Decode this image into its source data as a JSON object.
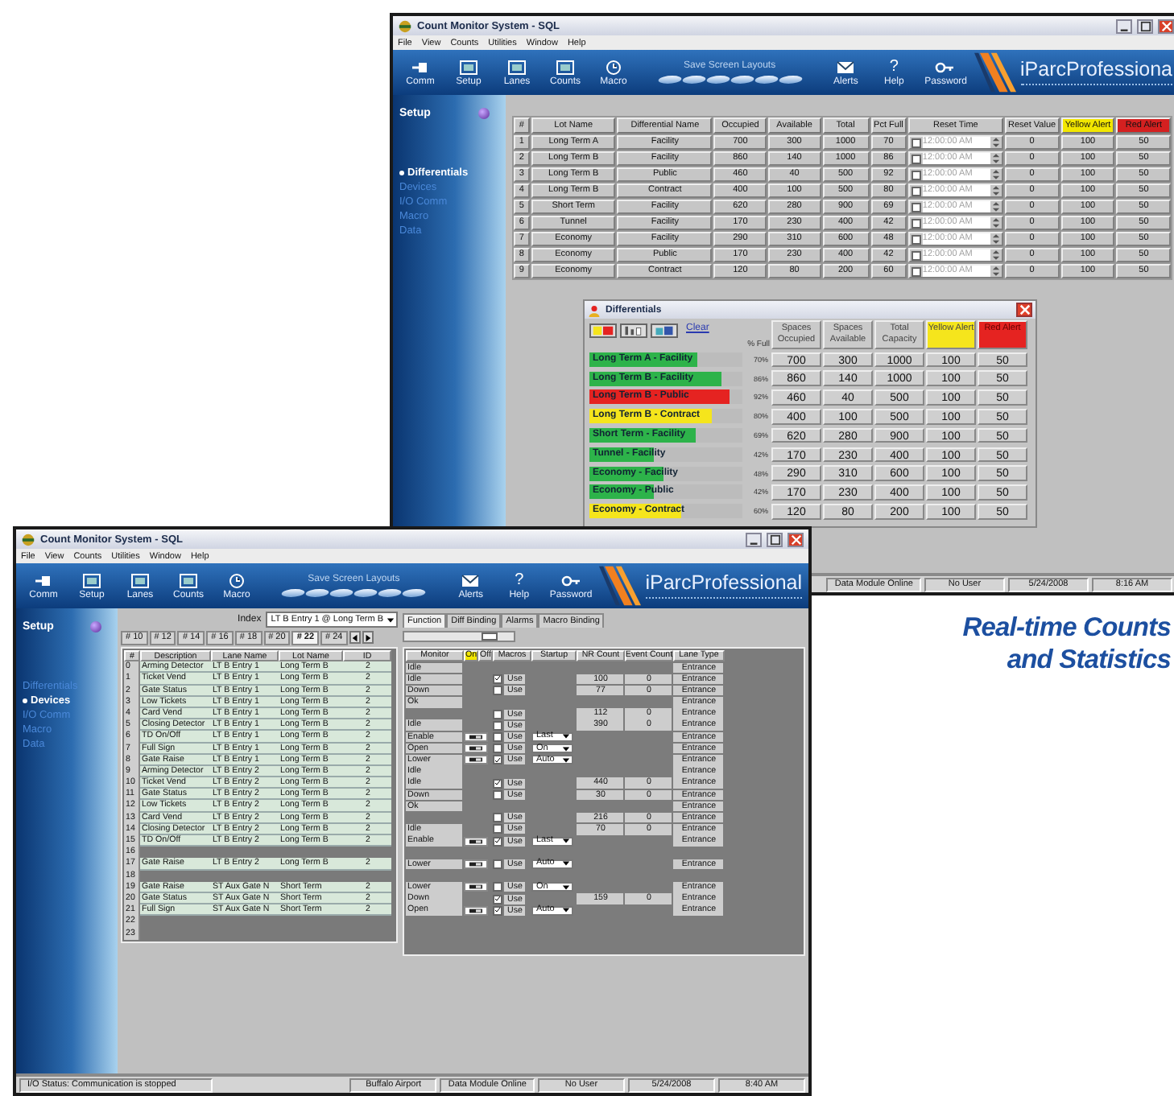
{
  "windows": [
    {
      "kind": "differentials",
      "title": "Count Monitor System - SQL",
      "menu": [
        "File",
        "View",
        "Counts",
        "Utilities",
        "Window",
        "Help"
      ],
      "toolbar": {
        "left": [
          {
            "kind": "plug",
            "label": "Comm"
          },
          {
            "kind": "screen",
            "label": "Setup"
          },
          {
            "kind": "screen",
            "label": "Lanes"
          },
          {
            "kind": "screen",
            "label": "Counts"
          },
          {
            "kind": "clock",
            "label": "Macro"
          }
        ],
        "layouts_label": "Save Screen Layouts",
        "right": [
          {
            "kind": "envelope",
            "label": "Alerts"
          },
          {
            "kind": "glyph",
            "glyph": "?",
            "label": "Help"
          },
          {
            "kind": "key",
            "label": "Password"
          }
        ],
        "logo": "iParcProfessiona"
      },
      "sidebar": {
        "title": "Setup",
        "items": [
          {
            "label": "Differentials",
            "selected": true
          },
          {
            "label": "Devices",
            "selected": false
          },
          {
            "label": "I/O Comm",
            "selected": false
          },
          {
            "label": "Macro",
            "selected": false
          },
          {
            "label": "Data",
            "selected": false
          }
        ]
      },
      "table": {
        "columns": [
          {
            "label": "#"
          },
          {
            "label": "Lot Name"
          },
          {
            "label": "Differential Name"
          },
          {
            "label": "Occupied"
          },
          {
            "label": "Available"
          },
          {
            "label": "Total"
          },
          {
            "label": "Pct Full"
          },
          {
            "label": "Reset Time"
          },
          {
            "label": "Reset Value"
          },
          {
            "label": "Yellow Alert",
            "color": "#f2e600"
          },
          {
            "label": "Red Alert",
            "color": "#d42020"
          }
        ],
        "rows": [
          {
            "no": "1",
            "lot": "Long Term A",
            "diff": "Facility",
            "occupied": "700",
            "available": "300",
            "total": "1000",
            "pct": "70",
            "reset_checked": false,
            "reset_enabled": false,
            "reset_time": "12:00:00 AM",
            "reset_value": "0",
            "yellow": "100",
            "red": "50"
          },
          {
            "no": "2",
            "lot": "Long Term B",
            "diff": "Facility",
            "occupied": "860",
            "available": "140",
            "total": "1000",
            "pct": "86",
            "reset_checked": false,
            "reset_enabled": false,
            "reset_time": "12:00:00 AM",
            "reset_value": "0",
            "yellow": "100",
            "red": "50"
          },
          {
            "no": "3",
            "lot": "Long Term B",
            "diff": "Public",
            "occupied": "460",
            "available": "40",
            "total": "500",
            "pct": "92",
            "reset_checked": false,
            "reset_enabled": false,
            "reset_time": "12:00:00 AM",
            "reset_value": "0",
            "yellow": "100",
            "red": "50"
          },
          {
            "no": "4",
            "lot": "Long Term B",
            "diff": "Contract",
            "occupied": "400",
            "available": "100",
            "total": "500",
            "pct": "80",
            "reset_checked": false,
            "reset_enabled": false,
            "reset_time": "12:00:00 AM",
            "reset_value": "0",
            "yellow": "100",
            "red": "50"
          },
          {
            "no": "5",
            "lot": "Short Term",
            "diff": "Facility",
            "occupied": "620",
            "available": "280",
            "total": "900",
            "pct": "69",
            "reset_checked": false,
            "reset_enabled": false,
            "reset_time": "12:00:00 AM",
            "reset_value": "0",
            "yellow": "100",
            "red": "50"
          },
          {
            "no": "6",
            "lot": "Tunnel",
            "diff": "Facility",
            "occupied": "170",
            "available": "230",
            "total": "400",
            "pct": "42",
            "reset_checked": false,
            "reset_enabled": false,
            "reset_time": "12:00:00 AM",
            "reset_value": "0",
            "yellow": "100",
            "red": "50"
          },
          {
            "no": "7",
            "lot": "Economy",
            "diff": "Facility",
            "occupied": "290",
            "available": "310",
            "total": "600",
            "pct": "48",
            "reset_checked": false,
            "reset_enabled": false,
            "reset_time": "12:00:00 AM",
            "reset_value": "0",
            "yellow": "100",
            "red": "50"
          },
          {
            "no": "8",
            "lot": "Economy",
            "diff": "Public",
            "occupied": "170",
            "available": "230",
            "total": "400",
            "pct": "42",
            "reset_checked": false,
            "reset_enabled": false,
            "reset_time": "12:00:00 AM",
            "reset_value": "0",
            "yellow": "100",
            "red": "50"
          },
          {
            "no": "9",
            "lot": "Economy",
            "diff": "Contract",
            "occupied": "120",
            "available": "80",
            "total": "200",
            "pct": "60",
            "reset_checked": false,
            "reset_enabled": false,
            "reset_time": "12:00:00 AM",
            "reset_value": "0",
            "yellow": "100",
            "red": "50"
          }
        ]
      },
      "status_bar": [
        "Data Module Online",
        "No User",
        "5/24/2008",
        "8:16 AM"
      ]
    },
    {
      "kind": "devices",
      "title": "Count Monitor System - SQL",
      "menu": [
        "File",
        "View",
        "Counts",
        "Utilities",
        "Window",
        "Help"
      ],
      "toolbar": {
        "left": [
          {
            "kind": "plug",
            "label": "Comm"
          },
          {
            "kind": "screen",
            "label": "Setup"
          },
          {
            "kind": "screen",
            "label": "Lanes"
          },
          {
            "kind": "screen",
            "label": "Counts"
          },
          {
            "kind": "clock",
            "label": "Macro"
          }
        ],
        "layouts_label": "Save Screen Layouts",
        "right": [
          {
            "kind": "envelope",
            "label": "Alerts"
          },
          {
            "kind": "glyph",
            "glyph": "?",
            "label": "Help"
          },
          {
            "kind": "key",
            "label": "Password"
          }
        ],
        "logo": "iParcProfessional"
      },
      "sidebar": {
        "title": "Setup",
        "items": [
          {
            "label": "Differentials",
            "selected": false
          },
          {
            "label": "Devices",
            "selected": true
          },
          {
            "label": "I/O Comm",
            "selected": false
          },
          {
            "label": "Macro",
            "selected": false
          },
          {
            "label": "Data",
            "selected": false
          }
        ]
      },
      "index": {
        "label": "Index",
        "value": "LT B Entry 1 @ Long Term B"
      },
      "lane_tabs": [
        {
          "label": "# 10",
          "selected": false
        },
        {
          "label": "# 12",
          "selected": false
        },
        {
          "label": "# 14",
          "selected": false
        },
        {
          "label": "# 16",
          "selected": false
        },
        {
          "label": "# 18",
          "selected": false
        },
        {
          "label": "# 20",
          "selected": false
        },
        {
          "label": "# 22",
          "selected": true
        },
        {
          "label": "# 24",
          "selected": false
        }
      ],
      "function_tabs": [
        {
          "label": "Function",
          "selected": true
        },
        {
          "label": "Diff Binding",
          "selected": false
        },
        {
          "label": "Alarms",
          "selected": false
        },
        {
          "label": "Macro Binding",
          "selected": false
        }
      ],
      "device_table": {
        "columns": [
          "#",
          "Description",
          "Lane Name",
          "Lot Name",
          "ID"
        ],
        "rows": [
          {
            "no": "0",
            "description": "Arming Detector",
            "lane": "LT B Entry 1",
            "lot": "Long Term B",
            "id": "2"
          },
          {
            "no": "1",
            "description": "Ticket Vend",
            "lane": "LT B Entry 1",
            "lot": "Long Term B",
            "id": "2"
          },
          {
            "no": "2",
            "description": "Gate Status",
            "lane": "LT B Entry 1",
            "lot": "Long Term B",
            "id": "2"
          },
          {
            "no": "3",
            "description": "Low Tickets",
            "lane": "LT B Entry 1",
            "lot": "Long Term B",
            "id": "2"
          },
          {
            "no": "4",
            "description": "Card Vend",
            "lane": "LT B Entry 1",
            "lot": "Long Term B",
            "id": "2"
          },
          {
            "no": "5",
            "description": "Closing Detector",
            "lane": "LT B Entry 1",
            "lot": "Long Term B",
            "id": "2"
          },
          {
            "no": "6",
            "description": "TD On/Off",
            "lane": "LT B Entry 1",
            "lot": "Long Term B",
            "id": "2"
          },
          {
            "no": "7",
            "description": "Full Sign",
            "lane": "LT B Entry 1",
            "lot": "Long Term B",
            "id": "2"
          },
          {
            "no": "8",
            "description": "Gate Raise",
            "lane": "LT B Entry 1",
            "lot": "Long Term B",
            "id": "2"
          },
          {
            "no": "9",
            "description": "Arming Detector",
            "lane": "LT B Entry 2",
            "lot": "Long Term B",
            "id": "2"
          },
          {
            "no": "10",
            "description": "Ticket Vend",
            "lane": "LT B Entry 2",
            "lot": "Long Term B",
            "id": "2"
          },
          {
            "no": "11",
            "description": "Gate Status",
            "lane": "LT B Entry 2",
            "lot": "Long Term B",
            "id": "2"
          },
          {
            "no": "12",
            "description": "Low Tickets",
            "lane": "LT B Entry 2",
            "lot": "Long Term B",
            "id": "2"
          },
          {
            "no": "13",
            "description": "Card Vend",
            "lane": "LT B Entry 2",
            "lot": "Long Term B",
            "id": "2"
          },
          {
            "no": "14",
            "description": "Closing Detector",
            "lane": "LT B Entry 2",
            "lot": "Long Term B",
            "id": "2"
          },
          {
            "no": "15",
            "description": "TD On/Off",
            "lane": "LT B Entry 2",
            "lot": "Long Term B",
            "id": "2"
          },
          {
            "no": "16"
          },
          {
            "no": "17",
            "description": "Gate Raise",
            "lane": "LT B Entry 2",
            "lot": "Long Term B",
            "id": "2"
          },
          {
            "no": "18"
          },
          {
            "no": "19",
            "description": "Gate Raise",
            "lane": "ST Aux Gate N",
            "lot": "Short Term",
            "id": "2"
          },
          {
            "no": "20",
            "description": "Gate Status",
            "lane": "ST Aux Gate N",
            "lot": "Short Term",
            "id": "2"
          },
          {
            "no": "21",
            "description": "Full Sign",
            "lane": "ST Aux Gate N",
            "lot": "Short Term",
            "id": "2"
          },
          {
            "no": "22"
          },
          {
            "no": "23"
          }
        ]
      },
      "monitor_table": {
        "columns": [
          "Monitor",
          "On",
          "Off",
          "Macros",
          "Startup",
          "NR Count",
          "Event Count",
          "Lane Type"
        ],
        "rows": [
          {
            "monitor": "Idle",
            "lane_type": "Entrance"
          },
          {
            "monitor": "Idle",
            "use": "Use",
            "use_checked": true,
            "nr_count": "100",
            "event_count": "0",
            "lane_type": "Entrance"
          },
          {
            "monitor": "Down",
            "use": "Use",
            "use_checked": false,
            "nr_count": "77",
            "event_count": "0",
            "lane_type": "Entrance"
          },
          {
            "monitor": "Ok",
            "lane_type": "Entrance"
          },
          {
            "use": "Use",
            "use_checked": false,
            "nr_count": "112",
            "event_count": "0",
            "lane_type": "Entrance"
          },
          {
            "monitor": "Idle",
            "use": "Use",
            "use_checked": false,
            "nr_count": "390",
            "event_count": "0",
            "lane_type": "Entrance"
          },
          {
            "monitor": "Enable",
            "switch": true,
            "use": "Use",
            "use_checked": false,
            "startup": "Last",
            "lane_type": "Entrance"
          },
          {
            "monitor": "Open",
            "switch": true,
            "use": "Use",
            "use_checked": false,
            "startup": "On",
            "lane_type": "Entrance"
          },
          {
            "monitor": "Lower",
            "switch": true,
            "use": "Use",
            "use_checked": true,
            "startup": "Auto",
            "lane_type": "Entrance"
          },
          {
            "monitor": "Idle",
            "lane_type": "Entrance"
          },
          {
            "monitor": "Idle",
            "use": "Use",
            "use_checked": true,
            "nr_count": "440",
            "event_count": "0",
            "lane_type": "Entrance"
          },
          {
            "monitor": "Down",
            "use": "Use",
            "use_checked": false,
            "nr_count": "30",
            "event_count": "0",
            "lane_type": "Entrance"
          },
          {
            "monitor": "Ok",
            "lane_type": "Entrance"
          },
          {
            "use": "Use",
            "use_checked": false,
            "nr_count": "216",
            "event_count": "0",
            "lane_type": "Entrance"
          },
          {
            "monitor": "Idle",
            "use": "Use",
            "use_checked": false,
            "nr_count": "70",
            "event_count": "0",
            "lane_type": "Entrance"
          },
          {
            "monitor": "Enable",
            "switch": true,
            "use": "Use",
            "use_checked": true,
            "startup": "Last",
            "lane_type": "Entrance"
          },
          {},
          {
            "monitor": "Lower",
            "switch": true,
            "use": "Use",
            "use_checked": false,
            "startup": "Auto",
            "lane_type": "Entrance"
          },
          {},
          {
            "monitor": "Lower",
            "switch": true,
            "use": "Use",
            "use_checked": false,
            "startup": "On",
            "lane_type": "Entrance"
          },
          {
            "monitor": "Down",
            "use": "Use",
            "use_checked": true,
            "nr_count": "159",
            "event_count": "0",
            "lane_type": "Entrance"
          },
          {
            "monitor": "Open",
            "switch": true,
            "use": "Use",
            "use_checked": true,
            "startup": "Auto",
            "lane_type": "Entrance"
          },
          {},
          {}
        ]
      },
      "status_bar": [
        "I/O Status: Communication is stopped",
        "Buffalo Airport",
        "Data Module Online",
        "No User",
        "5/24/2008",
        "8:40 AM"
      ]
    }
  ],
  "differentials_popup": {
    "title": "Differentials",
    "clear": "Clear",
    "pct_label": "% Full",
    "columns": [
      "Spaces Occupied",
      "Spaces Available",
      "Total Capacity",
      "Yellow Alert",
      "Red Alert"
    ],
    "rows": [
      {
        "name": "Long Term A - Facility",
        "pct": "70%",
        "level": 0.7,
        "color": "#2db34a",
        "values": [
          "700",
          "300",
          "1000",
          "100",
          "50"
        ]
      },
      {
        "name": "Long Term B - Facility",
        "pct": "86%",
        "level": 0.86,
        "color": "#2db34a",
        "values": [
          "860",
          "140",
          "1000",
          "100",
          "50"
        ]
      },
      {
        "name": "Long Term B - Public",
        "pct": "92%",
        "level": 0.92,
        "color": "#e52321",
        "values": [
          "460",
          "40",
          "500",
          "100",
          "50"
        ]
      },
      {
        "name": "Long Term B - Contract",
        "pct": "80%",
        "level": 0.8,
        "color": "#f5e51c",
        "values": [
          "400",
          "100",
          "500",
          "100",
          "50"
        ]
      },
      {
        "name": "Short Term - Facility",
        "pct": "69%",
        "level": 0.69,
        "color": "#2db34a",
        "values": [
          "620",
          "280",
          "900",
          "100",
          "50"
        ]
      },
      {
        "name": "Tunnel - Facility",
        "pct": "42%",
        "level": 0.42,
        "color": "#2db34a",
        "values": [
          "170",
          "230",
          "400",
          "100",
          "50"
        ]
      },
      {
        "name": "Economy - Facility",
        "pct": "48%",
        "level": 0.48,
        "color": "#2db34a",
        "values": [
          "290",
          "310",
          "600",
          "100",
          "50"
        ]
      },
      {
        "name": "Economy - Public",
        "pct": "42%",
        "level": 0.42,
        "color": "#2db34a",
        "values": [
          "170",
          "230",
          "400",
          "100",
          "50"
        ]
      },
      {
        "name": "Economy - Contract",
        "pct": "60%",
        "level": 0.6,
        "color": "#f5e51c",
        "values": [
          "120",
          "80",
          "200",
          "100",
          "50"
        ]
      }
    ]
  },
  "caption": [
    "Real-time Counts",
    "and Statistics"
  ]
}
